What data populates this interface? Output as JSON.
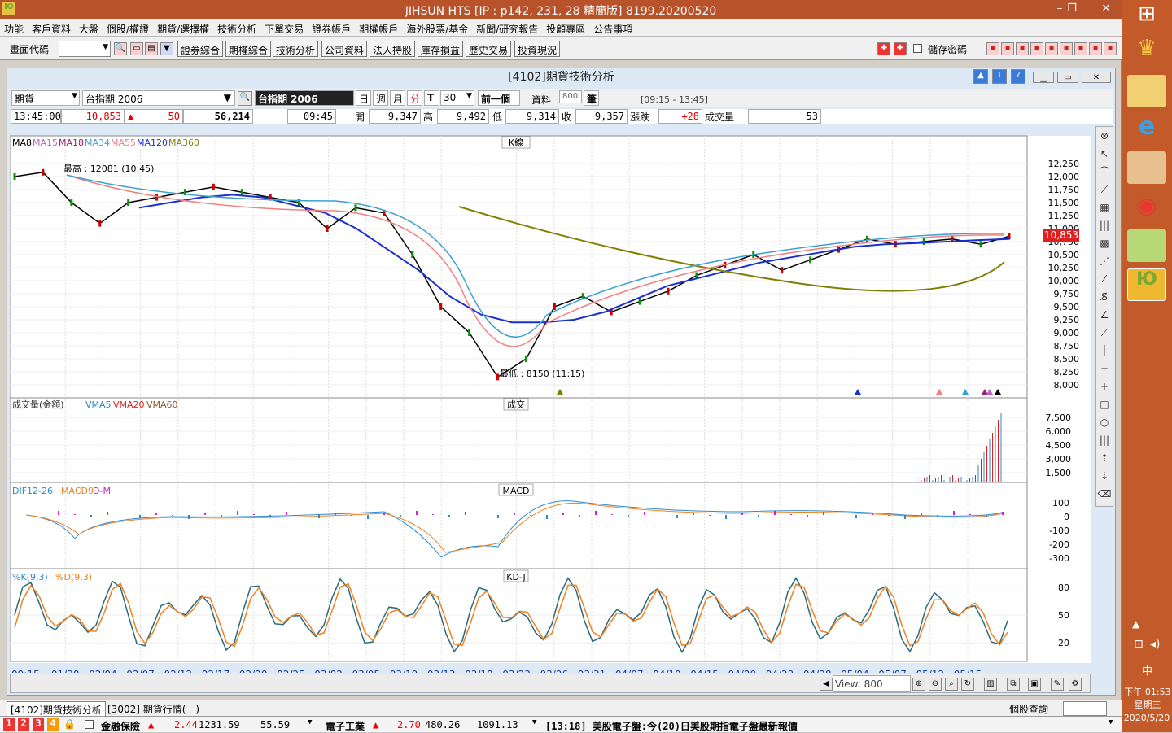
{
  "window": {
    "title": "JIHSUN HTS      [IP : p142, 231, 28 精簡版] 8199.20200520",
    "min": "–",
    "max": "❐",
    "close": "✕"
  },
  "menu": [
    "功能",
    "客戶資料",
    "大盤",
    "個股/權證",
    "期貨/選擇權",
    "技術分析",
    "下單交易",
    "證券帳戶",
    "期權帳戶",
    "海外股票/基金",
    "新聞/研究報告",
    "投顧專區",
    "公告事項"
  ],
  "toolbar": {
    "code_label": "畫面代碼",
    "buttons": [
      "證券綜合",
      "期權綜合",
      "技術分析",
      "公司資料",
      "法人持股",
      "庫存損益",
      "歷史交易",
      "投資現況"
    ],
    "save_pw": "儲存密碼"
  },
  "inner": {
    "title": "[4102]期貨技術分析"
  },
  "row1": {
    "type": "期貨",
    "name": "台指期 2006",
    "symbol": "台指期 2006",
    "d": "日",
    "w": "週",
    "m": "月",
    "min": "分",
    "t": "T",
    "period": "30",
    "prev": "前一個",
    "data_label": "資料",
    "data_val": "800",
    "unit": "筆",
    "range": "[09:15 - 13:45]"
  },
  "row2": {
    "time": "13:45:00",
    "price": "10,853",
    "change": "50",
    "volume": "56,214",
    "t2": "09:45",
    "open_l": "開",
    "open": "9,347",
    "high_l": "高",
    "high": "9,492",
    "low_l": "低",
    "low": "9,314",
    "close_l": "收",
    "close": "9,357",
    "chg_l": "漲跌",
    "chg": "+28",
    "vol_l": "成交量",
    "vol": "53"
  },
  "panels": {
    "k": {
      "title": "K線",
      "legend": [
        [
          "MA8",
          "#000000"
        ],
        [
          "MA15",
          "#c060c0"
        ],
        [
          "MA18",
          "#9b1f6b"
        ],
        [
          "MA34",
          "#3aa0d0"
        ],
        [
          "MA55",
          "#f08080"
        ],
        [
          "MA120",
          "#1a2fd4"
        ],
        [
          "MA360",
          "#808000"
        ]
      ],
      "hi": "最高 : 12081 (10:45)",
      "lo": "最低 : 8150 (11:15)",
      "ticks": [
        "12,250",
        "12,000",
        "11,750",
        "11,500",
        "11,250",
        "11,000",
        "10,750",
        "10,500",
        "10,250",
        "10,000",
        "9,750",
        "9,500",
        "9,250",
        "9,000",
        "8,750",
        "8,500",
        "8,250",
        "8,000"
      ],
      "last": "10,853"
    },
    "vol": {
      "title": "成交",
      "legend": [
        [
          "成交量(金額)",
          "#333333"
        ],
        [
          "VMA5",
          "#2a8ad0"
        ],
        [
          "VMA20",
          "#e02020"
        ],
        [
          "VMA60",
          "#8a5a2a"
        ]
      ],
      "ticks": [
        "7,500",
        "6,000",
        "4,500",
        "3,000",
        "1,500"
      ]
    },
    "macd": {
      "title": "MACD",
      "legend": [
        [
          "DIF12-26",
          "#2a8ad0"
        ],
        [
          "MACD9",
          "#f08020"
        ],
        [
          "D-M",
          "#d020d0"
        ]
      ],
      "ticks": [
        "100",
        "0",
        "-100",
        "-200",
        "-300"
      ]
    },
    "kd": {
      "title": "KD-J",
      "legend": [
        [
          "%K(9,3)",
          "#2a8ad0"
        ],
        [
          "%D(9,3)",
          "#f08020"
        ]
      ],
      "ticks": [
        "80",
        "50",
        "20"
      ]
    }
  },
  "xaxis": [
    "09:15",
    "01/30",
    "02/04",
    "02/07",
    "02/12",
    "02/17",
    "02/20",
    "02/25",
    "03/02",
    "03/05",
    "03/10",
    "03/13",
    "03/18",
    "03/23",
    "03/26",
    "03/31",
    "04/07",
    "04/10",
    "04/15",
    "04/20",
    "04/23",
    "04/28",
    "05/04",
    "05/07",
    "05/12",
    "05/15"
  ],
  "nav": {
    "view": "View: 800"
  },
  "tabs": [
    "[4102]期貨技術分析",
    "[3002]  期貨行情(一)"
  ],
  "tabright": "個股查詢",
  "status": {
    "a": "金融保險",
    "a_chg": "2.44",
    "a_idx": "1231.59",
    "a_v": "55.59",
    "b": "電子工業",
    "b_chg": "2.70",
    "b_idx": "480.26",
    "b_v": "1091.13",
    "news": "[13:18] 美股電子盤:今(20)日美股期指電子盤最新報價"
  },
  "taskbar": {
    "time": "下午 01:53",
    "day": "星期三",
    "date": "2020/5/20",
    "ime": "中"
  },
  "chart_data": {
    "type": "line",
    "title": "K線",
    "series": [
      {
        "name": "Price",
        "values": [
          12000,
          12081,
          11500,
          11100,
          11500,
          11600,
          11700,
          11800,
          11700,
          11600,
          11500,
          11000,
          11400,
          11300,
          10500,
          9500,
          9000,
          8150,
          8500,
          9500,
          9700,
          9400,
          9600,
          9800,
          10100,
          10300,
          10500,
          10200,
          10400,
          10600,
          10800,
          10700,
          10750,
          10800,
          10700,
          10853
        ]
      },
      {
        "name": "MA120",
        "values": [
          null,
          null,
          null,
          null,
          11400,
          11500,
          11600,
          11650,
          11600,
          11450,
          11300,
          11000,
          10600,
          10200,
          9700,
          9350,
          9200,
          9200,
          9250,
          9400,
          9650,
          9900,
          10050,
          10200,
          10350,
          10450,
          10550,
          10650,
          10700,
          10720,
          10750,
          10780,
          10800
        ]
      }
    ]
  }
}
